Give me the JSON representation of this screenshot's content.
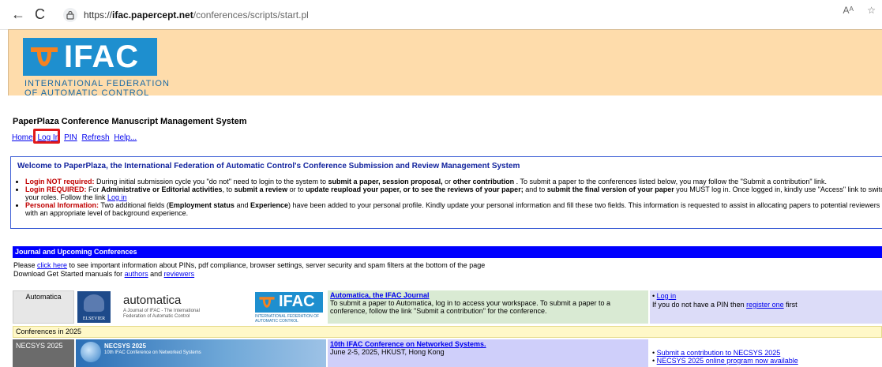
{
  "browser": {
    "back_icon": "←",
    "reload_icon": "C",
    "url_scheme": "https://",
    "url_host": "ifac.papercept.net",
    "url_path": "/conferences/scripts/start.pl",
    "reader_icon": "Aᴬ",
    "star_icon": "☆"
  },
  "header": {
    "logo_text": "IFAC",
    "logo_sub_line1": "INTERNATIONAL FEDERATION",
    "logo_sub_line2": "OF AUTOMATIC CONTROL",
    "brand_color": "#1e8fcf",
    "header_bg": "#fedcab"
  },
  "page": {
    "system_title": "PaperPlaza Conference Manuscript Management System",
    "nav": {
      "home": "Home",
      "login": "Log In",
      "pin": "PIN",
      "refresh": "Refresh",
      "help": "Help..."
    }
  },
  "welcome": {
    "title": "Welcome to PaperPlaza, the International Federation of Automatic Control's Conference Submission and Review Management System",
    "item1_label": "Login NOT required:",
    "item1_text_a": " During initial submission cycle you \"do not\" need to login to the system to ",
    "item1_bold": "submit a paper, session proposal,",
    "item1_text_b": " or ",
    "item1_bold2": "other contribution",
    "item1_text_c": " . To submit a paper to the conferences listed below, you may follow the \"Submit a contribution\" link.",
    "item2_label": "Login REQUIRED:",
    "item2_text_a": " For ",
    "item2_bold": "Administrative or Editorial activities",
    "item2_text_b": ", to ",
    "item2_bold2": "submit a review",
    "item2_text_c": " or to ",
    "item2_bold3": "update reupload your paper, or to see the reviews of your paper;",
    "item2_text_d": " and to ",
    "item2_bold4": "submit the final version of your paper",
    "item2_text_e": " you MUST log in. Once logged in, kindly use \"Access\" link to switch",
    "item2_line2": "your roles. Follow the link ",
    "item2_link": "Log in",
    "item3_label": "Personal Information:",
    "item3_text_a": " Two additional fields (",
    "item3_bold": "Employment status",
    "item3_text_b": " and ",
    "item3_bold2": "Experience",
    "item3_text_c": ") have been added to your personal profile. Kindly update your personal information and fill these two fields. This information is requested to assist in allocating papers to potential reviewers",
    "item3_line2": "with an appropriate level of background experience."
  },
  "journal": {
    "bar_title": "Journal and Upcoming Conferences",
    "info_prefix": "Please ",
    "info_link": "click here",
    "info_suffix": " to see important information about PINs, pdf compliance, browser settings, server security and spam filters at the bottom of the page",
    "manuals_prefix": "Download Get Started manuals for ",
    "authors_link": "authors",
    "and_text": " and ",
    "reviewers_link": "reviewers"
  },
  "automatica": {
    "label": "Automatica",
    "elsevier": "ELSEVIER",
    "journal_name": "automatica",
    "journal_sub": "A Journal of IFAC - The International Federation of Automatic Control",
    "small_ifac": "IFAC",
    "small_ifac_sub": "INTERNATIONAL FEDERATION OF AUTOMATIC CONTROL",
    "desc_link": "Automatica, the IFAC Journal",
    "desc_text": "To submit a paper to Automatica, log in to access your workspace. To submit a paper to a conference, follow the link \"Submit a contribution\" for the conference.",
    "side_login": "Log in",
    "side_text_a": "If you do not have a PIN then ",
    "side_register": "register one",
    "side_text_b": " first"
  },
  "conferences": {
    "year_label": "Conferences in 2025"
  },
  "necsys": {
    "label": "NECSYS 2025",
    "banner_title": "NECSYS 2025",
    "banner_sub": "10th IFAC Conference on Networked Systems",
    "desc_link": "10th IFAC Conference on Networked Systems.",
    "desc_text": "June 2-5, 2025, HKUST, Hong Kong",
    "side_item1": "Submit a contribution to NECSYS 2025",
    "side_item2": "NECSYS 2025 online program now available"
  }
}
